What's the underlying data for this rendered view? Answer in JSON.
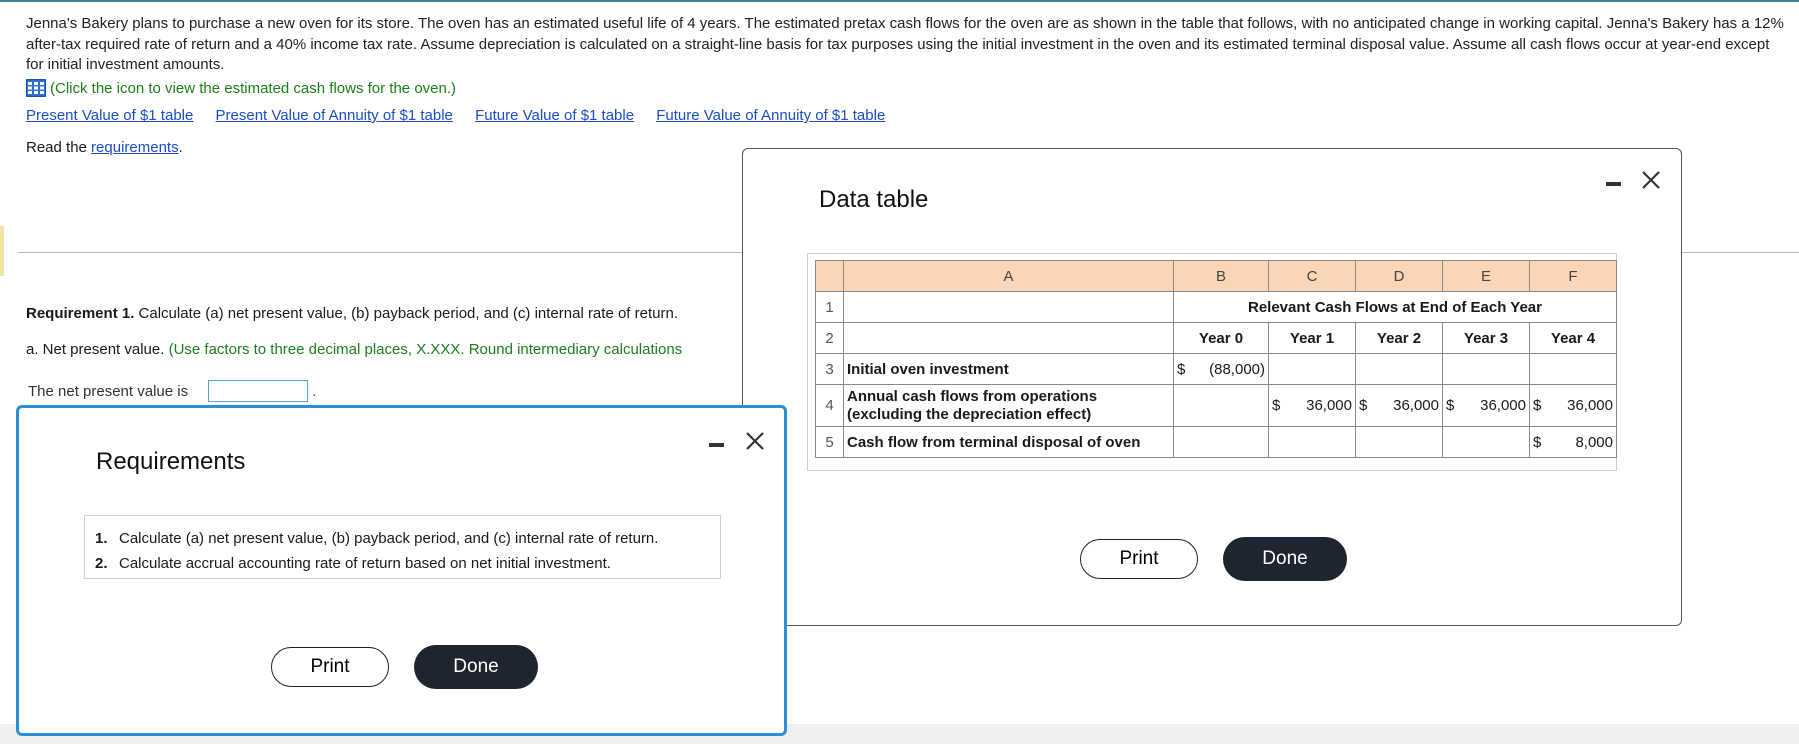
{
  "problem_text": "Jenna's Bakery plans to purchase a new oven for its store. The oven has an estimated useful life of 4 years. The estimated pretax cash flows for the oven are as shown in the table that follows, with no anticipated change in working capital. Jenna's Bakery has a 12% after-tax required rate of return and a 40% income tax rate. Assume depreciation is calculated on a straight-line basis for tax purposes using the initial investment in the oven and its estimated terminal disposal value. Assume all cash flows occur at year-end except for initial investment amounts.",
  "hint": "(Click the icon to view the estimated cash flows for the oven.)",
  "links": [
    "Present Value of $1 table",
    "Present Value of Annuity of $1 table",
    "Future Value of $1 table",
    "Future Value of Annuity of $1 table"
  ],
  "read_prefix": "Read the ",
  "read_link": "requirements",
  "read_suffix": ".",
  "req1_bold": "Requirement 1.",
  "req1_text": " Calculate (a) net present value, (b) payback period, and (c) internal rate of return.",
  "part_a_label": "a. Net present value.",
  "part_a_hint": " (Use factors to three decimal places, X.XXX. Round intermediary calculations",
  "npv_label": "The net present value is",
  "npv_value": "",
  "npv_suffix": ".",
  "data_table": {
    "title": "Data table",
    "col_letters": [
      "A",
      "B",
      "C",
      "D",
      "E",
      "F"
    ],
    "header_span": "Relevant Cash Flows at End of Each Year",
    "years": [
      "Year 0",
      "Year 1",
      "Year 2",
      "Year 3",
      "Year 4"
    ],
    "row_numbers": [
      "1",
      "2",
      "3",
      "4",
      "5"
    ],
    "row3_label": "Initial oven investment",
    "row3_cur": "$",
    "row3_value": "(88,000)",
    "row4_label_line1": "Annual cash flows from operations",
    "row4_label_line2": "(excluding the depreciation effect)",
    "row4_cur": "$",
    "row4_values": [
      "36,000",
      "36,000",
      "36,000",
      "36,000"
    ],
    "row5_label": "Cash flow from terminal disposal of oven",
    "row5_cur": "$",
    "row5_value": "8,000",
    "print_label": "Print",
    "done_label": "Done"
  },
  "requirements": {
    "title": "Requirements",
    "items": [
      {
        "num": "1.",
        "text": "Calculate (a) net present value, (b) payback period, and (c) internal rate of return."
      },
      {
        "num": "2.",
        "text": "Calculate accrual accounting rate of return based on net initial investment."
      }
    ],
    "print_label": "Print",
    "done_label": "Done"
  },
  "colors": {
    "link": "#1a4ec2",
    "hint": "#1b7f1b",
    "header_fill": "#fbd5b5",
    "done_button": "#1f2530",
    "modal_focus": "#2b8fd6"
  }
}
